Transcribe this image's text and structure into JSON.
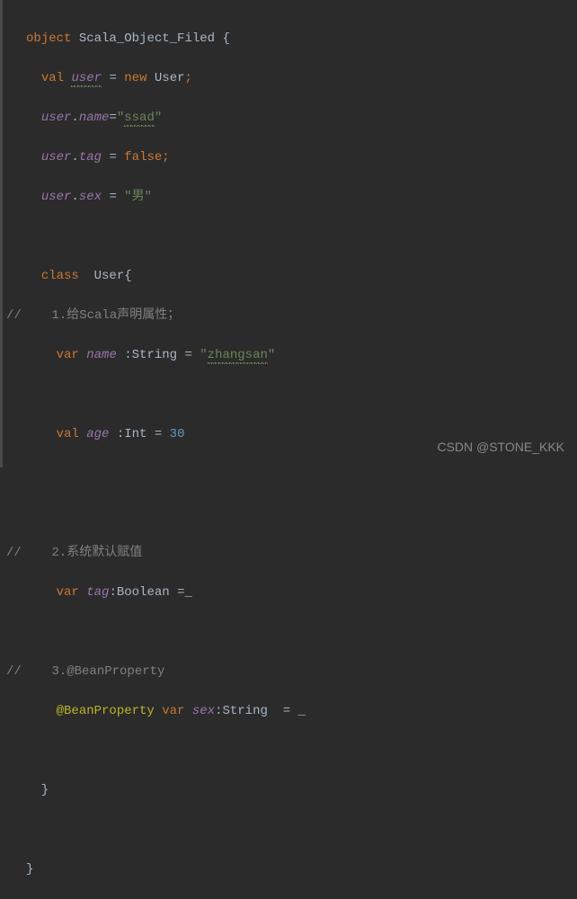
{
  "code": {
    "l1_kw_object": "object",
    "l1_name": "Scala_Object_Filed",
    "l1_brace": " {",
    "l2_kw_val": "val",
    "l2_user": "user",
    "l2_eq": " = ",
    "l2_kw_new": "new",
    "l2_type": " User",
    "l2_semi": ";",
    "l3_user": "user",
    "l3_dot": ".",
    "l3_name": "name",
    "l3_eq": "=",
    "l3_q1": "\"",
    "l3_str": "ssad",
    "l3_q2": "\"",
    "l4_user": "user",
    "l4_dot": ".",
    "l4_tag": "tag",
    "l4_eq": " = ",
    "l4_false": "false",
    "l4_semi": ";",
    "l5_user": "user",
    "l5_dot": ".",
    "l5_sex": "sex",
    "l5_eq": " = ",
    "l5_str": "\"男\"",
    "l7_kw_class": "class",
    "l7_name": "  User{",
    "l8_comment": "//    1.给Scala声明属性；",
    "l9_kw_var": "var",
    "l9_name": "name",
    "l9_colon": " :String = ",
    "l9_q1": "\"",
    "l9_str": "zhangsan",
    "l9_q2": "\"",
    "l11_kw_val": "val",
    "l11_age": "age",
    "l11_colon": " :Int = ",
    "l11_num": "30",
    "l14_comment": "//    2.系统默认赋值",
    "l15_kw_var": "var",
    "l15_tag": "tag",
    "l15_rest": ":Boolean =_",
    "l17_comment": "//    3.@BeanProperty",
    "l18_anno": "@BeanProperty",
    "l18_kw_var": "var",
    "l18_sex": "sex",
    "l18_rest": ":String  = _",
    "l20_brace": "  }",
    "l22_brace": "}"
  },
  "watermark": "CSDN @STONE_KKK"
}
